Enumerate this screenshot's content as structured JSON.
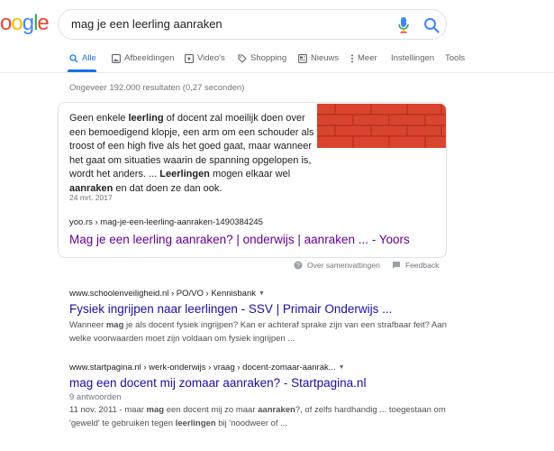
{
  "logo": {
    "text": "oogle",
    "letters": [
      "o",
      "o",
      "g",
      "l",
      "e"
    ]
  },
  "search": {
    "query": "mag je een leerling aanraken"
  },
  "tabs": [
    {
      "label": "Alle",
      "icon": "search-icon"
    },
    {
      "label": "Afbeeldingen",
      "icon": "image-icon"
    },
    {
      "label": "Video's",
      "icon": "play-icon"
    },
    {
      "label": "Shopping",
      "icon": "tag-icon"
    },
    {
      "label": "Nieuws",
      "icon": "news-icon"
    },
    {
      "label": "Meer",
      "icon": "more-vert-icon"
    },
    {
      "label": "Instellingen"
    },
    {
      "label": "Tools"
    }
  ],
  "stats": "Ongeveer 192.000 resultaten (0,27 seconden)",
  "featured": {
    "text_segments": [
      {
        "t": "Geen enkele ",
        "b": false
      },
      {
        "t": "leerling",
        "b": true
      },
      {
        "t": " of docent zal moeilijk doen over een bemoedigend klopje, een arm om een schouder als troost of een high five als het goed gaat, maar wanneer het gaat om situaties waarin de spanning opgelopen is, wordt het anders. ... ",
        "b": false
      },
      {
        "t": "Leerlingen",
        "b": true
      },
      {
        "t": " mogen elkaar wel ",
        "b": false
      },
      {
        "t": "aanraken",
        "b": true
      },
      {
        "t": " en dat doen ze dan ook.",
        "b": false
      }
    ],
    "date": "24 mrt. 2017",
    "url": "yoo.rs › mag-je-een-leerling-aanraken-1490384245",
    "title": "Mag je een leerling aanraken? | onderwijs | aanraken ... - Yoors",
    "image_color": "#d9442f"
  },
  "about": {
    "summary_label": "Over samenvattingen",
    "feedback_label": "Feedback"
  },
  "results": [
    {
      "cite": "www.schoolenveiligheid.nl › PO/VO › Kennisbank",
      "title": "Fysiek ingrijpen naar leerlingen - SSV | Primair Onderwijs ...",
      "desc_segments": [
        {
          "t": "Wanneer ",
          "b": false
        },
        {
          "t": "mag",
          "b": true
        },
        {
          "t": " je als docent fysiek ingrijpen? Kan er achteraf sprake zijn van een strafbaar feit? Aan welke voorwaarden moet zijn voldaan om fysiek ingrijpen ...",
          "b": false
        }
      ]
    },
    {
      "cite": "www.startpagina.nl › werk-onderwijs › vraag › docent-zomaar-aanrak...",
      "title": "mag een docent mij zomaar aanraken? - Startpagina.nl",
      "meta": "9 antwoorden",
      "desc_segments": [
        {
          "t": "11 nov. 2011 - maar ",
          "b": false
        },
        {
          "t": "mag",
          "b": true
        },
        {
          "t": " een docent mij zo maar ",
          "b": false
        },
        {
          "t": "aanraken",
          "b": true
        },
        {
          "t": "?, of zelfs hardhandig ... toegestaan om 'geweld' te gebruiken tegen ",
          "b": false
        },
        {
          "t": "leerlingen",
          "b": true
        },
        {
          "t": " bij 'noodweer of ...",
          "b": false
        }
      ]
    }
  ],
  "colors": {
    "link": "#1a0dab",
    "visited": "#660099",
    "accent": "#1a73e8",
    "google_blue": "#4285f4",
    "google_red": "#ea4335",
    "google_yellow": "#fbbc05",
    "google_green": "#34a853"
  }
}
